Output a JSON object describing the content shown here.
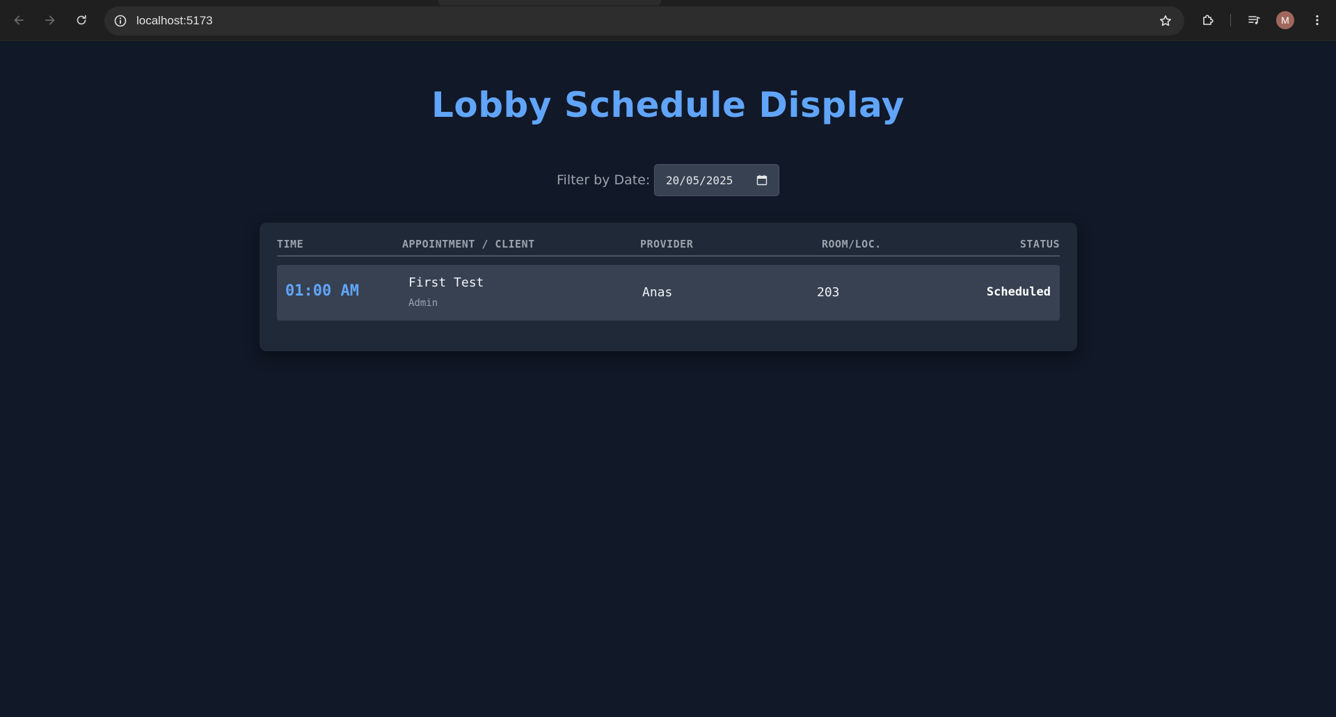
{
  "browser": {
    "url": "localhost:5173",
    "profile_initial": "M",
    "icons": {
      "back": "arrow-left-icon",
      "forward": "arrow-right-icon",
      "reload": "reload-icon",
      "site_info": "info-icon",
      "bookmark": "star-icon",
      "extensions": "puzzle-icon",
      "media": "media-queue-icon",
      "menu": "kebab-menu-icon"
    }
  },
  "page": {
    "title": "Lobby Schedule Display",
    "filter": {
      "label": "Filter by Date:",
      "value": "20/05/2025"
    },
    "table": {
      "headers": {
        "time": "TIME",
        "appointment": "APPOINTMENT / CLIENT",
        "provider": "PROVIDER",
        "room": "ROOM/LOC.",
        "status": "STATUS"
      },
      "rows": [
        {
          "time": "01:00 AM",
          "appointment": "First Test",
          "client": "Admin",
          "provider": "Anas",
          "room": "203",
          "status": "Scheduled"
        }
      ]
    }
  },
  "colors": {
    "background": "#111827",
    "panel": "#1f2937",
    "row": "#374151",
    "accent": "#60a5fa",
    "muted_text": "#9ca3af"
  }
}
